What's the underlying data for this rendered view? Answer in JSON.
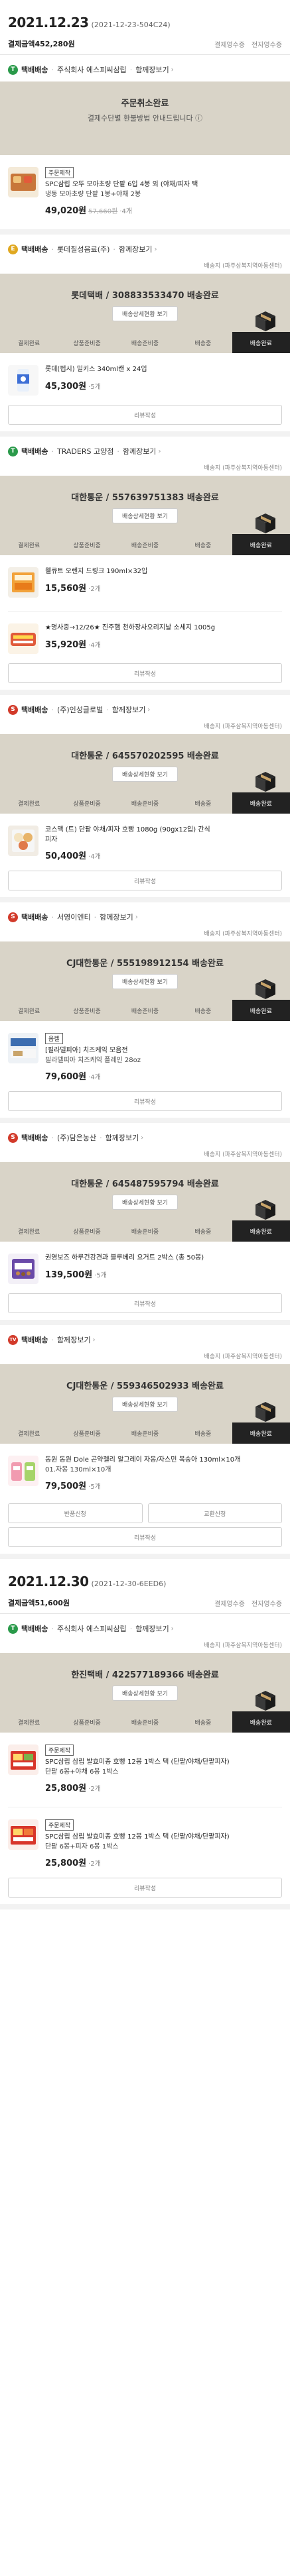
{
  "common": {
    "together": "함께장보기",
    "chev": "›",
    "delivery_track": "배송상세현황 보기",
    "review": "리뷰작성",
    "direct": "택배(주)(자유상재(지역제휴)한)",
    "steps": [
      "결제완료",
      "상품준비중",
      "배송준비중",
      "배송중",
      "배송완료"
    ],
    "receipt_links": [
      "결제영수증",
      "전자영수증"
    ]
  },
  "orders": [
    {
      "date": "2021.12.23",
      "order_id": "(2021-12-23-504C24)",
      "pay_amount": "결제금액452,280원",
      "shipments": [
        {
          "badge": "T",
          "badge_class": "t",
          "head": "택배배송",
          "vendor": "주식회사 에스피씨삼립",
          "status_title": "주문취소완료",
          "status_note": "결제수단별 환불방법 안내드립니다 ⓘ",
          "cancel": true,
          "items": [
            {
              "tag": "주문제작",
              "name": "SPC삼립 오뚜 모아초량 단팥 6입 4봉 외 (야채/피자 택",
              "opt": "냉동 모아초량 단팥 1봉+야채 2봉",
              "price": "49,020원",
              "orig": "57,660원",
              "qty": "4개",
              "thumb": "bread"
            }
          ]
        },
        {
          "badge": "E",
          "badge_class": "e",
          "head": "택배배송",
          "vendor": "롯데칠성음료(주)",
          "sub": "배송지 (파주삼복지역아동센터)",
          "status_title": "롯데택배 / 308833533470 배송완료",
          "items": [
            {
              "name": "롯데(펩시) 밀키스 340ml캔 x 24입",
              "price": "45,300원",
              "qty": "5개",
              "thumb": "can"
            }
          ]
        },
        {
          "badge": "T",
          "badge_class": "t",
          "head": "택배배송",
          "vendor": "TRADERS 고양점",
          "sub": "배송지 (파주삼복지역아동센터)",
          "status_title": "대한통운 / 557639751383 배송완료",
          "items": [
            {
              "name": "웰큐트 오렌지 드링크 190ml×32입",
              "price": "15,560원",
              "qty": "2개",
              "thumb": "juice"
            },
            {
              "name": "★명사중→12/26★ 진주햄 천하장사오리지날 소세지 1005g",
              "price": "35,920원",
              "qty": "4개",
              "thumb": "sausage"
            }
          ]
        },
        {
          "badge": "S",
          "badge_class": "s",
          "head": "택배배송",
          "vendor": "(주)인성글로벌",
          "sub": "배송지 (파주삼복지역아동센터)",
          "status_title": "대한통운 / 645570202595 배송완료",
          "items": [
            {
              "name": "코스맥 (트) 단팥 야채/피자 호빵 1080g (90gx12입) 간식",
              "opt": "피자",
              "price": "50,400원",
              "qty": "4개",
              "thumb": "bun"
            }
          ]
        },
        {
          "badge": "S",
          "badge_class": "s",
          "head": "택배배송",
          "vendor": "서영이엔티",
          "sub": "배송지 (파주삼복지역아동센터)",
          "status_title": "CJ대한통운 / 555198912154 배송완료",
          "items": [
            {
              "tag": "옵켈",
              "name": "[필라델피아] 치즈케익 모음전",
              "opt": "필라델피아 치즈케익 플레인 28oz",
              "price": "79,600원",
              "qty": "4개",
              "thumb": "cake"
            }
          ]
        },
        {
          "badge": "S",
          "badge_class": "s",
          "head": "택배배송",
          "vendor": "(주)담은농산",
          "sub": "배송지 (파주삼복지역아동센터)",
          "status_title": "대한통운 / 645487595794 배송완료",
          "items": [
            {
              "name": "권영보즈 하루건강견과 블루베리 요거트 2박스 (총 50봉)",
              "price": "139,500원",
              "qty": "5개",
              "thumb": "nuts"
            }
          ]
        },
        {
          "badge": "TV",
          "badge_class": "tv",
          "head": "택배배송",
          "vendor": "",
          "sub": "배송지 (파주삼복지역아동센터)",
          "status_title": "CJ대한통운 / 559346502933 배송완료",
          "pair_buttons": [
            "반품신청",
            "교환신청"
          ],
          "items": [
            {
              "name": "동원 동원 Dole 곤약젤리 알그레이 자몽/자스민 복숭아 130ml×10개",
              "opt": "01.자몽 130ml×10개",
              "price": "79,500원",
              "qty": "5개",
              "thumb": "jelly"
            }
          ]
        }
      ]
    },
    {
      "date": "2021.12.30",
      "order_id": "(2021-12-30-6EED6)",
      "pay_amount": "결제금액51,600원",
      "shipments": [
        {
          "badge": "T",
          "badge_class": "t",
          "head": "택배배송",
          "vendor": "주식회사 에스피씨삼립",
          "sub": "배송지 (파주삼복지역아동센터)",
          "status_title": "한진택배 / 422577189366 배송완료",
          "items": [
            {
              "tag": "주문제작",
              "name": "SPC삼립 삼립 발효미종 호빵 12봉 1박스 택 (단팥/야채/단팥피자)",
              "opt": "단팥 6봉+야채 6봉 1박스",
              "price": "25,800원",
              "qty": "2개",
              "thumb": "box1"
            },
            {
              "tag": "주문제작",
              "name": "SPC삼립 삼립 발효미종 호빵 12봉 1박스 택 (단팥/야채/단팥피자)",
              "opt": "단팥 6봉+피자 6봉 1박스",
              "price": "25,800원",
              "qty": "2개",
              "thumb": "box2"
            }
          ]
        }
      ]
    }
  ],
  "colors": {
    "status_bg": "#d9d4c8",
    "active_step": "#222222"
  }
}
